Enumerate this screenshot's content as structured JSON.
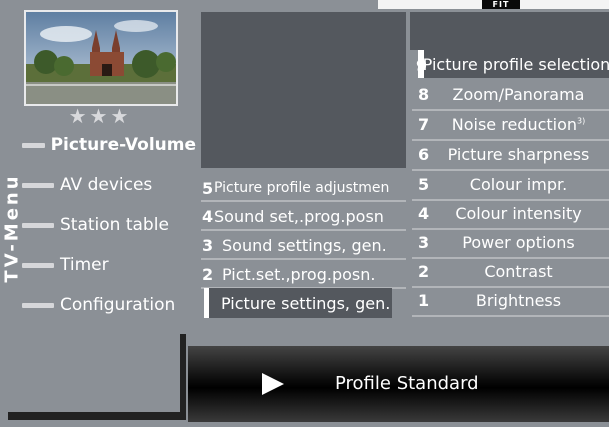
{
  "logo_text": "FIT",
  "stars": "★★★",
  "vertical_title": "TV-Menu",
  "left_menu": [
    {
      "label": "Picture-Volume"
    },
    {
      "label": "AV devices"
    },
    {
      "label": "Station table"
    },
    {
      "label": "Timer"
    },
    {
      "label": "Configuration"
    }
  ],
  "center_menu": [
    {
      "num": "5",
      "label": "Picture profile adjustmen"
    },
    {
      "num": "4",
      "label": "Sound set,.prog.posn"
    },
    {
      "num": "3",
      "label": "Sound settings, gen."
    },
    {
      "num": "2",
      "label": "Pict.set.,prog.posn."
    },
    {
      "num": "1",
      "label": "Picture settings, gen."
    }
  ],
  "right_menu": [
    {
      "num": "9",
      "label": "Picture profile selection"
    },
    {
      "num": "8",
      "label": "Zoom/Panorama"
    },
    {
      "num": "7",
      "label": "Noise reduction",
      "sup": "3)"
    },
    {
      "num": "6",
      "label": "Picture sharpness"
    },
    {
      "num": "5",
      "label": "Colour impr."
    },
    {
      "num": "4",
      "label": "Colour intensity"
    },
    {
      "num": "3",
      "label": "Power options"
    },
    {
      "num": "2",
      "label": "Contrast"
    },
    {
      "num": "1",
      "label": "Brightness"
    }
  ],
  "bottom_bar": {
    "label": "Profile Standard"
  },
  "colors": {
    "panel": "#8b9096",
    "dark": "#54585e",
    "text": "#ffffff"
  }
}
